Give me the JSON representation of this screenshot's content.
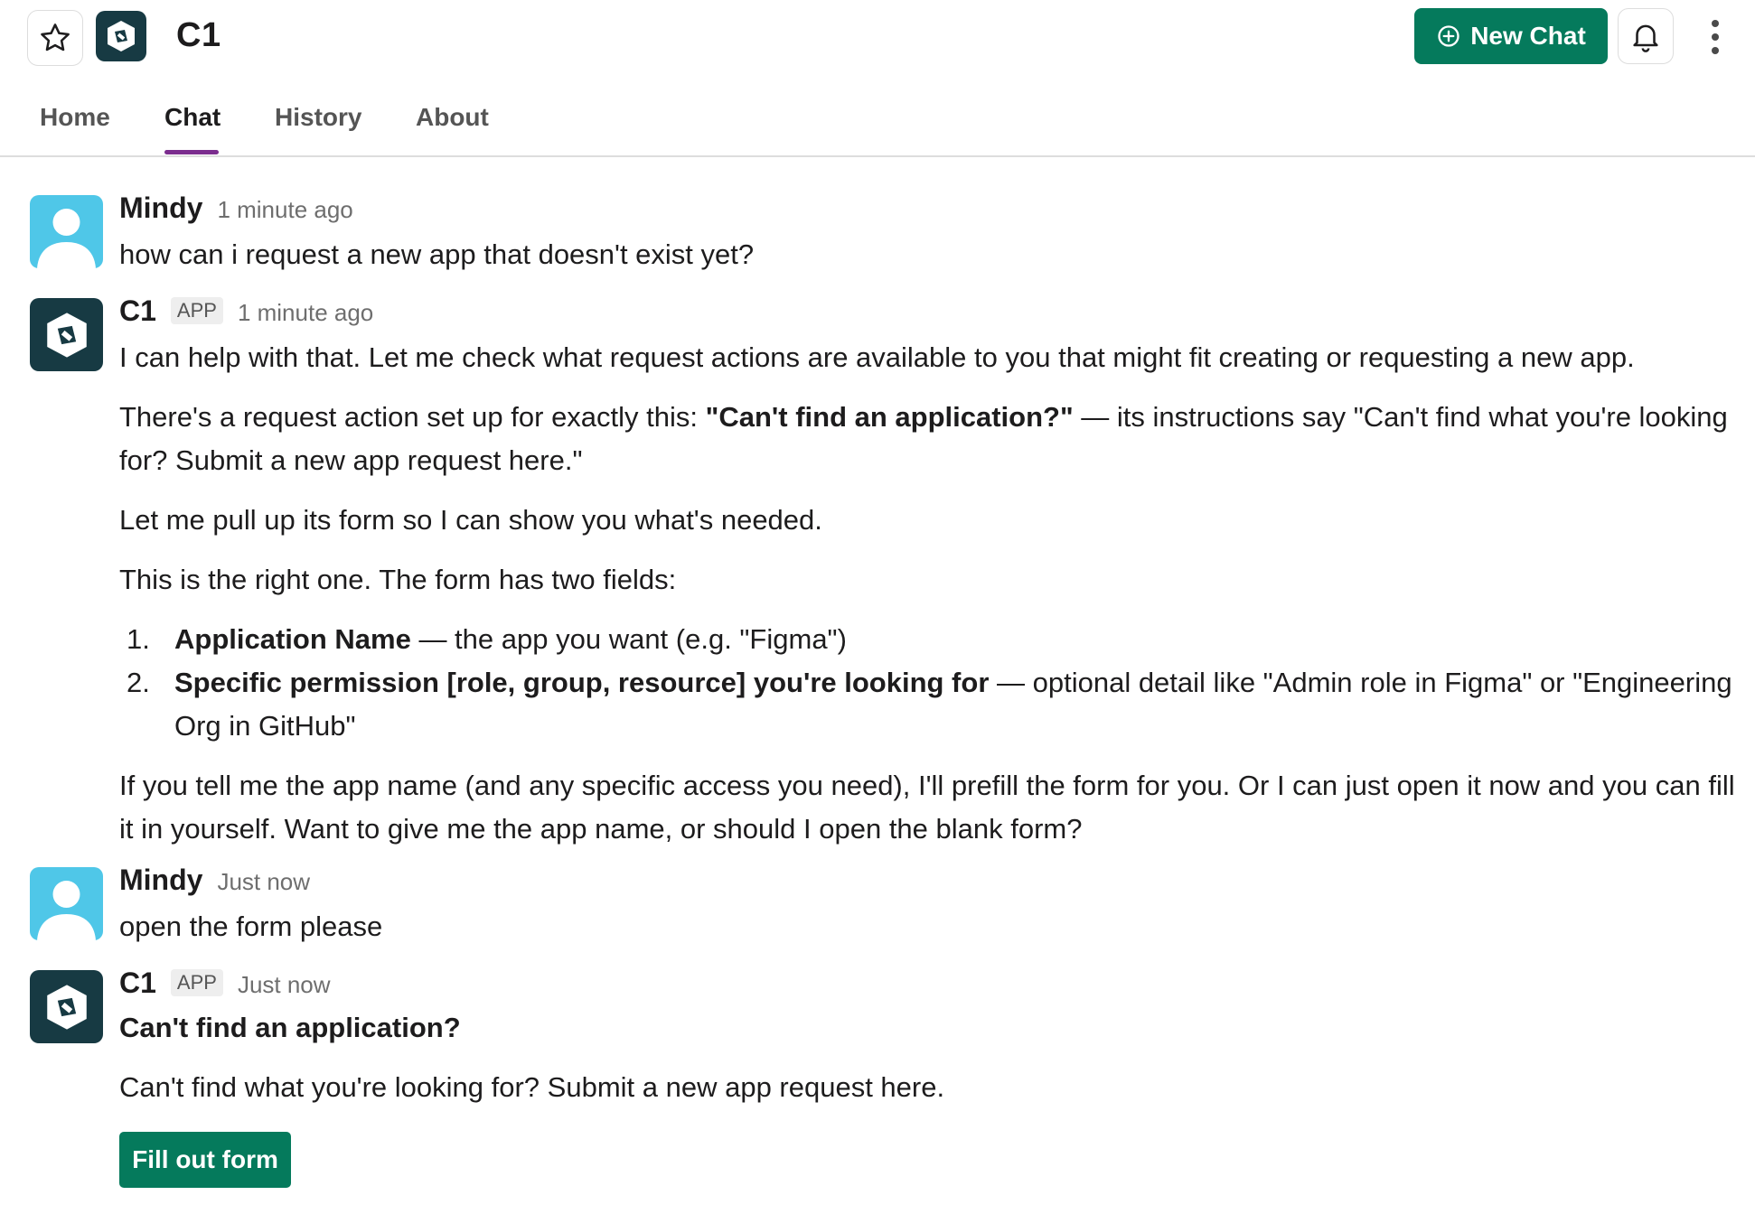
{
  "header": {
    "app_title": "C1",
    "new_chat_label": "New Chat"
  },
  "tabs": [
    {
      "label": "Home"
    },
    {
      "label": "Chat"
    },
    {
      "label": "History"
    },
    {
      "label": "About"
    }
  ],
  "active_tab": "Chat",
  "messages": {
    "m1": {
      "author": "Mindy",
      "time": "1 minute ago",
      "text": "how can i request a new app that doesn't exist yet?"
    },
    "m2": {
      "author": "C1",
      "badge": "APP",
      "time": "1 minute ago",
      "p1": "I can help with that. Let me check what request actions are available to you that might fit creating or requesting a new app.",
      "p2_pre": "There's a request action set up for exactly this: ",
      "p2_bold": "\"Can't find an application?\"",
      "p2_post": " — its instructions say \"Can't find what you're looking for? Submit a new app request here.\"",
      "p3": "Let me pull up its form so I can show you what's needed.",
      "p4": "This is the right one. The form has two fields:",
      "list": [
        {
          "num": "1.",
          "bold": "Application Name",
          "rest": " — the app you want (e.g. \"Figma\")"
        },
        {
          "num": "2.",
          "bold": "Specific permission [role, group, resource] you're looking for",
          "rest": " — optional detail like \"Admin role in Figma\" or \"Engineering Org in GitHub\""
        }
      ],
      "p5": "If you tell me the app name (and any specific access you need), I'll prefill the form for you. Or I can just open it now and you can fill it in yourself. Want to give me the app name, or should I open the blank form?"
    },
    "m3": {
      "author": "Mindy",
      "time": "Just now",
      "text": "open the form please"
    },
    "m4": {
      "author": "C1",
      "badge": "APP",
      "time": "Just now",
      "form_title": "Can't find an application?",
      "form_desc": "Can't find what you're looking for? Submit a new app request here.",
      "button_label": "Fill out form"
    }
  },
  "colors": {
    "primary_green": "#057a5c",
    "active_tab_underline": "#7b2d8e",
    "logo_bg": "#173a43",
    "user_avatar_bg": "#4fc7e8"
  },
  "icons": [
    "star-icon",
    "c1-logo-icon",
    "plus-circle-icon",
    "bell-icon",
    "more-vertical-icon",
    "user-avatar-icon"
  ]
}
